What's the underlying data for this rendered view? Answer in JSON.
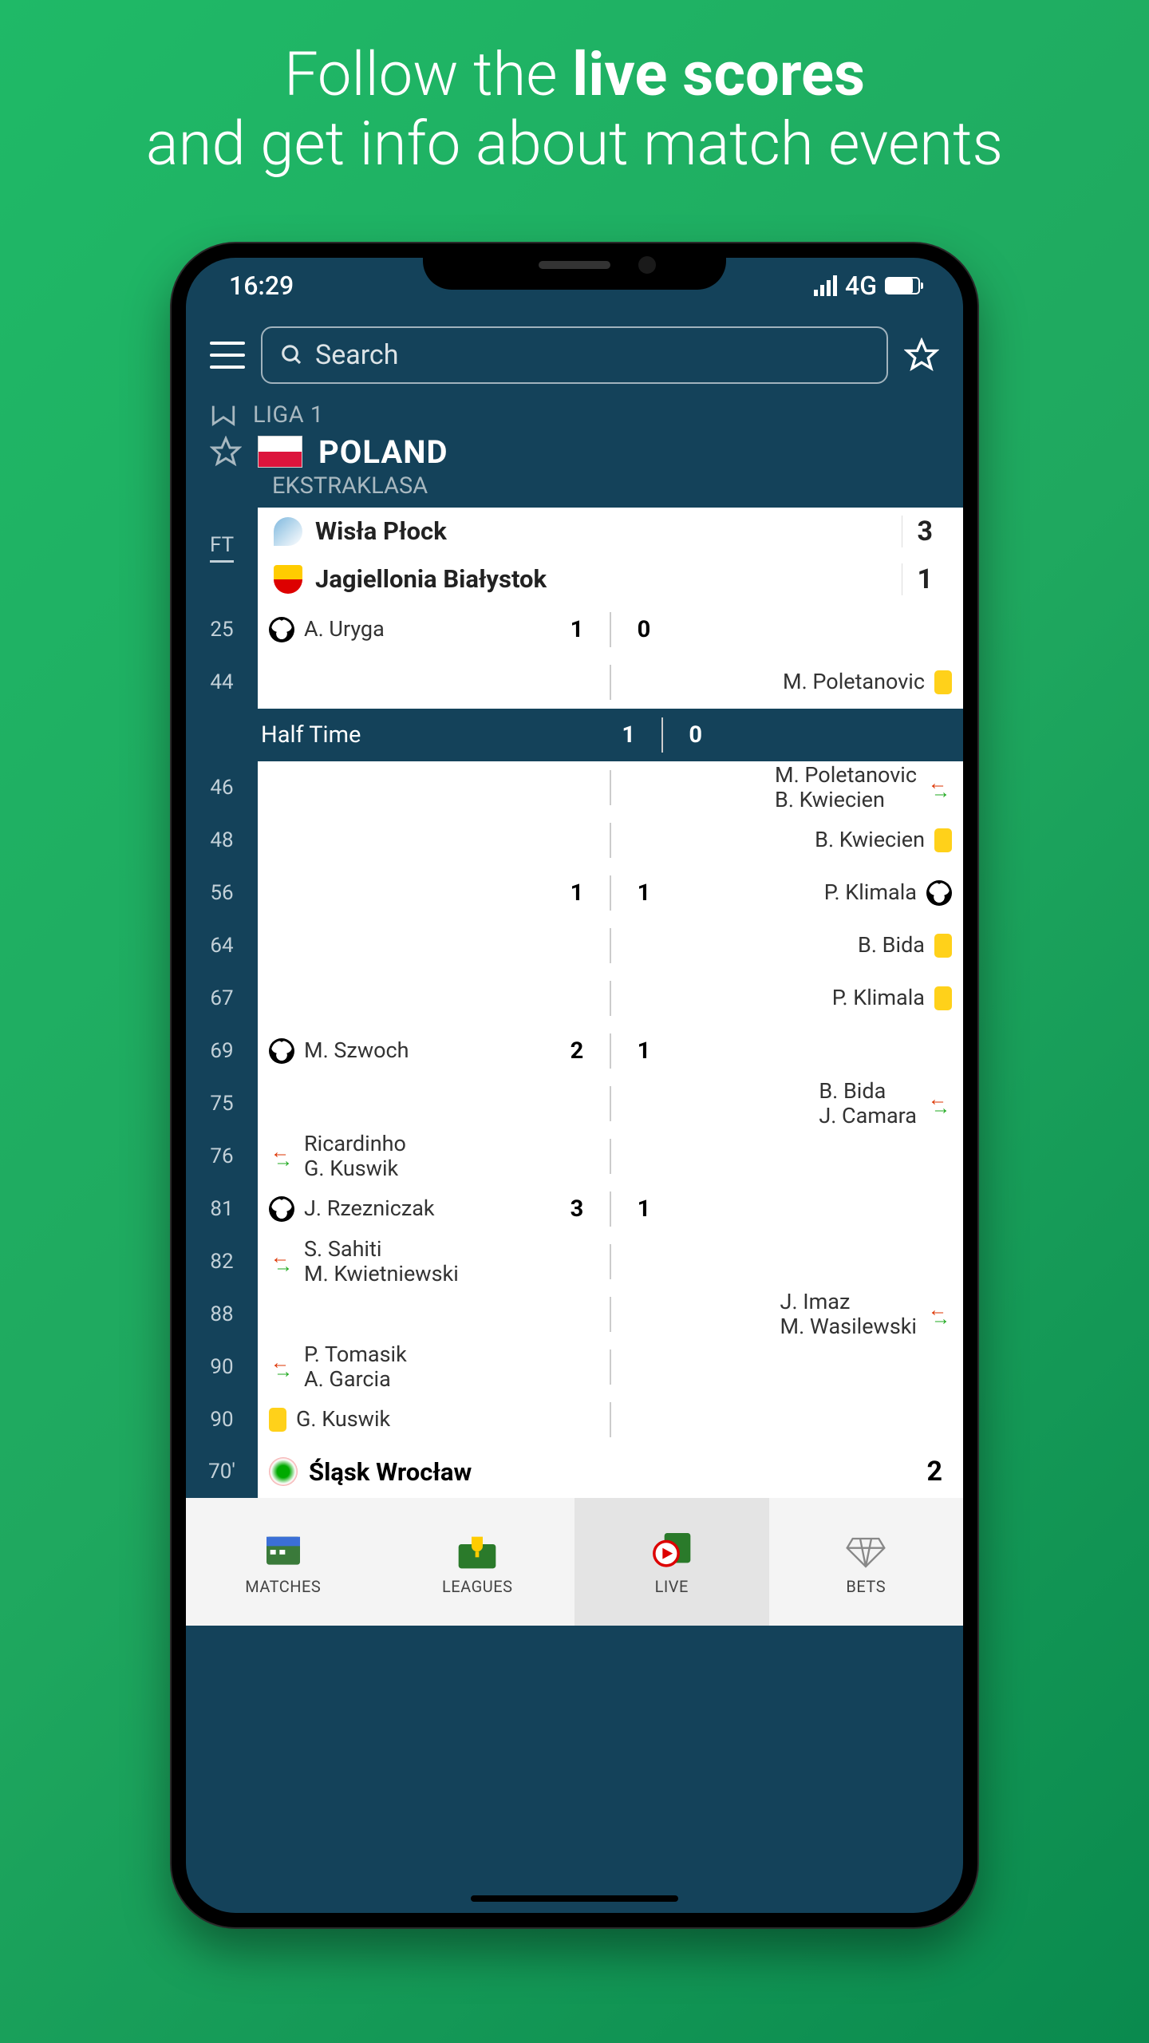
{
  "hero": {
    "line1_a": "Follow the ",
    "line1_b": "live scores",
    "line2": "and get info about match events"
  },
  "status": {
    "time": "16:29",
    "net": "4G"
  },
  "search": {
    "placeholder": "Search"
  },
  "league_above": "LIGA 1",
  "country": "POLAND",
  "league_sub": "EKSTRAKLASA",
  "ft": "FT",
  "teams": {
    "home": "Wisła Płock",
    "home_score": "3",
    "away": "Jagiellonia Białystok",
    "away_score": "1"
  },
  "ht": {
    "label": "Half Time",
    "h": "1",
    "a": "0"
  },
  "events": [
    {
      "min": "25",
      "home": {
        "kind": "goal",
        "n1": "A. Uryga"
      },
      "sh": "1",
      "sa": "0"
    },
    {
      "min": "44",
      "away": {
        "kind": "yellow",
        "n1": "M. Poletanovic"
      }
    },
    {
      "min": "46",
      "away": {
        "kind": "sub",
        "n1": "M. Poletanovic",
        "n2": "B. Kwiecien"
      }
    },
    {
      "min": "48",
      "away": {
        "kind": "yellow",
        "n1": "B. Kwiecien"
      }
    },
    {
      "min": "56",
      "away": {
        "kind": "goal",
        "n1": "P. Klimala"
      },
      "sh": "1",
      "sa": "1"
    },
    {
      "min": "64",
      "away": {
        "kind": "yellow",
        "n1": "B. Bida"
      }
    },
    {
      "min": "67",
      "away": {
        "kind": "yellow",
        "n1": "P. Klimala"
      }
    },
    {
      "min": "69",
      "home": {
        "kind": "goal",
        "n1": "M. Szwoch"
      },
      "sh": "2",
      "sa": "1"
    },
    {
      "min": "75",
      "away": {
        "kind": "sub",
        "n1": "B. Bida",
        "n2": "J. Camara"
      }
    },
    {
      "min": "76",
      "home": {
        "kind": "sub",
        "n1": "Ricardinho",
        "n2": "G. Kuswik"
      }
    },
    {
      "min": "81",
      "home": {
        "kind": "goal",
        "n1": "J. Rzezniczak"
      },
      "sh": "3",
      "sa": "1"
    },
    {
      "min": "82",
      "home": {
        "kind": "sub",
        "n1": "S. Sahiti",
        "n2": "M. Kwietniewski"
      }
    },
    {
      "min": "88",
      "away": {
        "kind": "sub",
        "n1": "J. Imaz",
        "n2": "M. Wasilewski"
      }
    },
    {
      "min": "90",
      "home": {
        "kind": "sub",
        "n1": "P. Tomasik",
        "n2": "A. Garcia"
      }
    },
    {
      "min": "90",
      "home": {
        "kind": "yellow",
        "n1": "G. Kuswik"
      }
    }
  ],
  "next_match": {
    "min": "70'",
    "name": "Śląsk Wrocław",
    "score": "2"
  },
  "nav": {
    "matches": "MATCHES",
    "leagues": "LEAGUES",
    "live": "LIVE",
    "bets": "BETS"
  }
}
